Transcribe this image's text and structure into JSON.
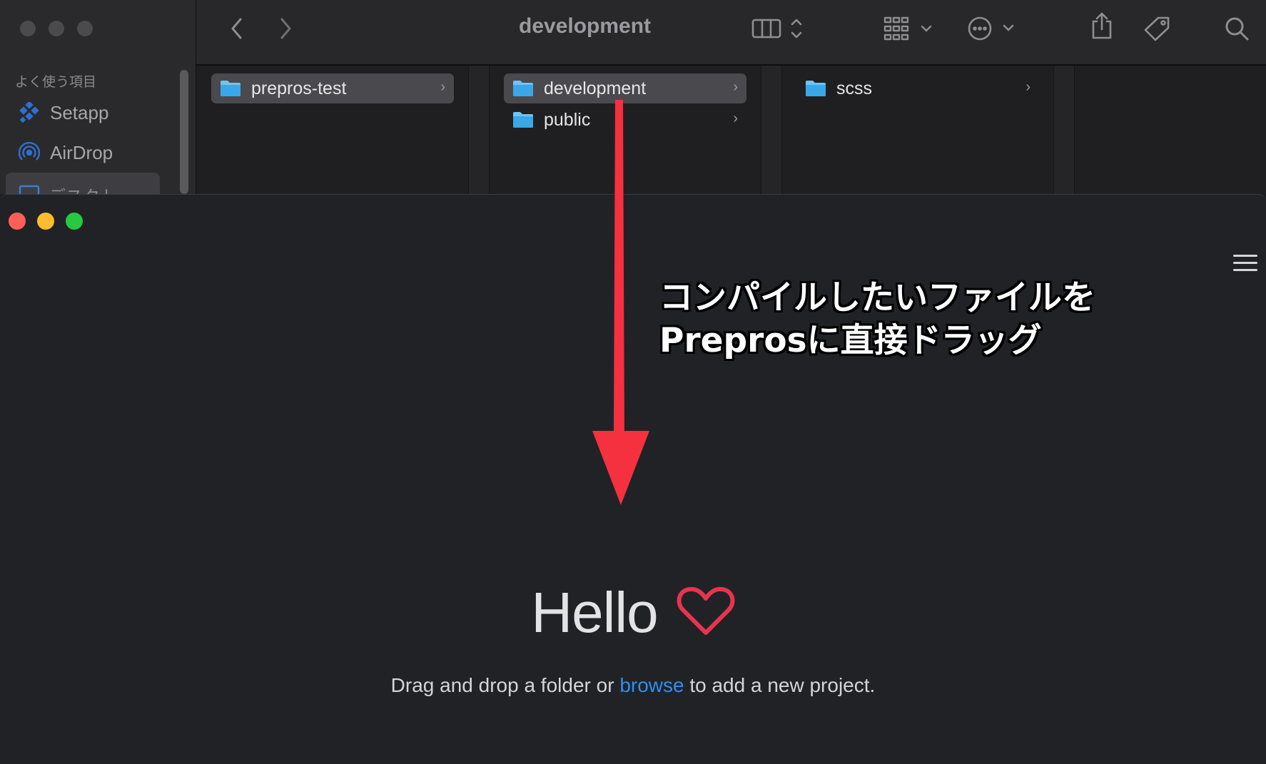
{
  "finder": {
    "sidebar": {
      "section_label": "よく使う項目",
      "items": [
        {
          "label": "Setapp",
          "icon": "setapp-icon"
        },
        {
          "label": "AirDrop",
          "icon": "airdrop-icon"
        },
        {
          "label": "デスクト…",
          "icon": "desktop-icon"
        }
      ]
    },
    "toolbar": {
      "title": "development",
      "back_icon": "chevron-left-icon",
      "forward_icon": "chevron-right-icon",
      "view_icon": "column-view-icon",
      "group_icon": "group-grid-icon",
      "action_icon": "more-actions-icon",
      "share_icon": "share-icon",
      "tag_icon": "tag-icon",
      "search_icon": "search-icon"
    },
    "columns": [
      {
        "items": [
          {
            "label": "prepros-test",
            "selected": true
          }
        ]
      },
      {
        "items": [
          {
            "label": "development",
            "selected": true
          },
          {
            "label": "public",
            "selected": false
          }
        ]
      },
      {
        "items": [
          {
            "label": "scss",
            "selected": false
          }
        ]
      }
    ],
    "chevron": "›",
    "colors": {
      "folder": "#3aa7e8",
      "folder_tab": "#6ec4f2"
    }
  },
  "prepros": {
    "hello": "Hello",
    "heart_color": "#e8344e",
    "tagline_before": "Drag and drop a folder or ",
    "tagline_link": "browse",
    "tagline_after": " to add a new project.",
    "link_color": "#2d8ff0",
    "traffic_lights": {
      "close": "#ff5f57",
      "minimize": "#febc2e",
      "maximize": "#28c840"
    }
  },
  "annotation": {
    "line1": "コンパイルしたいファイルを",
    "line2": "Preprosに直接ドラッグ",
    "arrow_color": "#f5303f"
  }
}
